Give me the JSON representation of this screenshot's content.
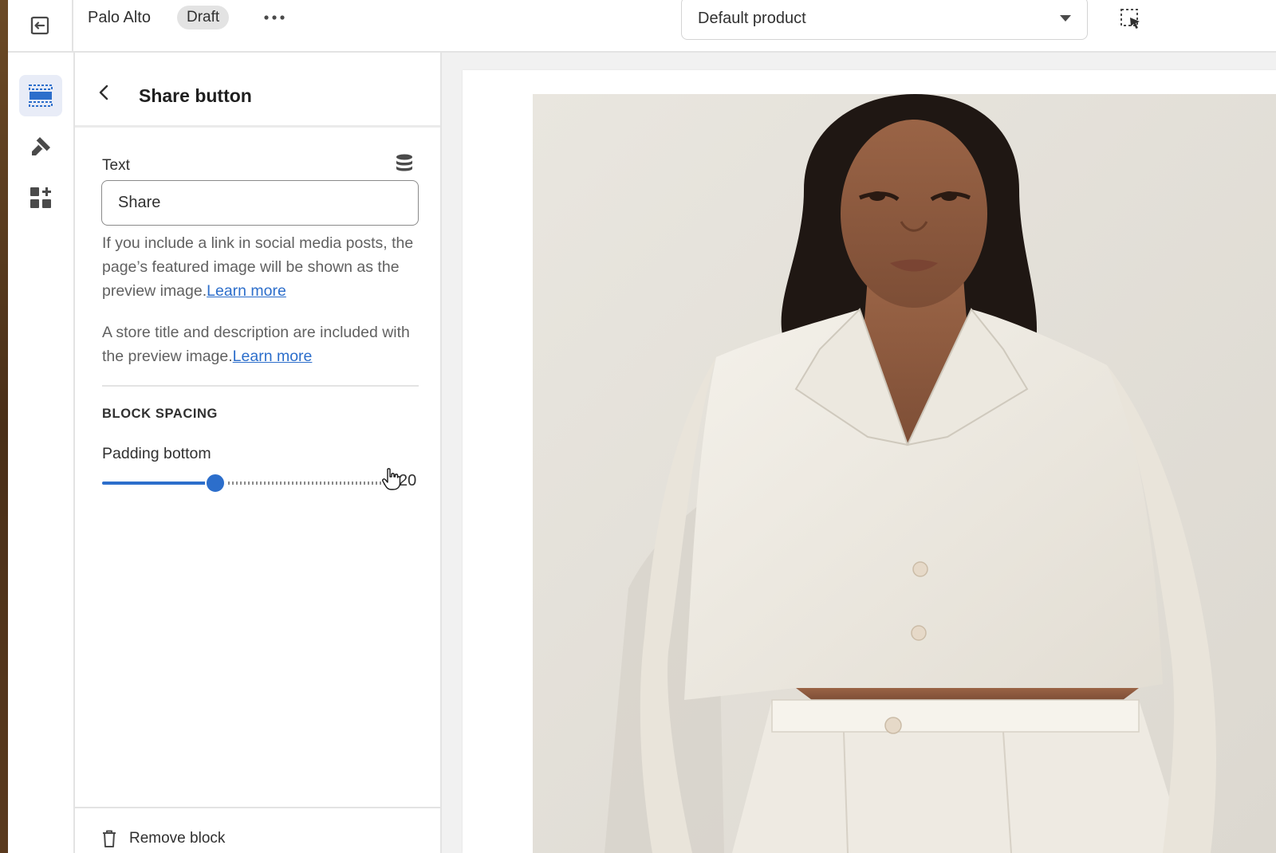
{
  "topbar": {
    "theme_name": "Palo Alto",
    "status_badge": "Draft",
    "template_select": "Default product",
    "icons": {
      "exit": "exit-icon",
      "more": "more-horizontal-icon",
      "inspector": "select-element-icon"
    }
  },
  "rail": {
    "items": [
      {
        "name": "sections",
        "icon": "sections-icon",
        "active": true
      },
      {
        "name": "theme-settings",
        "icon": "paint-brush-icon",
        "active": false
      },
      {
        "name": "apps",
        "icon": "apps-icon",
        "active": false
      }
    ]
  },
  "panel": {
    "title": "Share button",
    "text_field": {
      "label": "Text",
      "value": "Share",
      "placeholder": ""
    },
    "help1": {
      "text": "If you include a link in social media posts, the page’s featured image will be shown as the preview image.",
      "link": "Learn more"
    },
    "help2": {
      "text": "A store title and description are included with the preview image.",
      "link": "Learn more"
    },
    "section_heading": "BLOCK SPACING",
    "padding_bottom": {
      "label": "Padding bottom",
      "value_text": "20",
      "fraction": 0.4
    },
    "footer": {
      "remove_label": "Remove block"
    }
  },
  "colors": {
    "accent": "#2c6ecb",
    "active_rail_bg": "#e8ecf7",
    "panel_bg": "#ffffff",
    "canvas_bg": "#f1f1f1"
  }
}
